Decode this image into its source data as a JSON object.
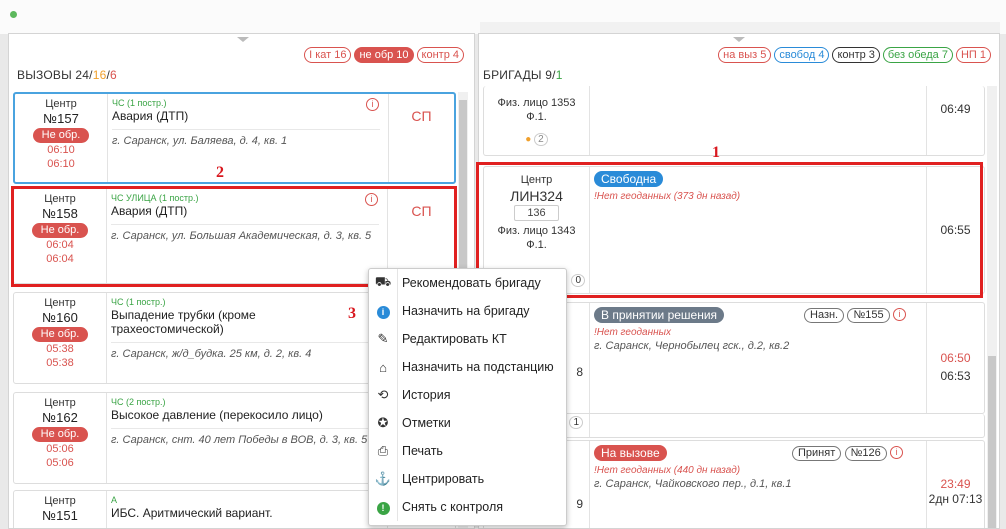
{
  "calls_panel": {
    "title_prefix": "ВЫЗОВЫ 24/",
    "title_a": "16",
    "title_sep": "/",
    "title_b": "6",
    "pills": [
      "I кат 16",
      "не обр 10",
      "контр 4"
    ]
  },
  "brigades_panel": {
    "title_prefix": "БРИГАДЫ 9/",
    "title_a": "1",
    "pills": [
      "на выз 5",
      "свобод 4",
      "контр 3",
      "без обеда 7",
      "НП 1"
    ]
  },
  "calls": [
    {
      "center": "Центр",
      "num": "№157",
      "status": "Не обр.",
      "t1": "06:10",
      "t2": "06:10",
      "cat": "ЧС (1 постр.)",
      "title": "Авария (ДТП)",
      "addr": "г. Саранск, ул. Баляева, д. 4, кв. 1",
      "code": "СП"
    },
    {
      "center": "Центр",
      "num": "№158",
      "status": "Не обр.",
      "t1": "06:04",
      "t2": "06:04",
      "cat": "ЧС УЛИЦА (1 постр.)",
      "title": "Авария (ДТП)",
      "addr": "г. Саранск, ул. Большая Академическая, д. 3, кв. 5",
      "code": "СП"
    },
    {
      "center": "Центр",
      "num": "№160",
      "status": "Не обр.",
      "t1": "05:38",
      "t2": "05:38",
      "cat": "ЧС (1 постр.)",
      "title": "Выпадение трубки (кроме трахеостомической)",
      "addr": "г. Саранск, ж/д_будка. 25 км, д. 2, кв. 4",
      "code": ""
    },
    {
      "center": "Центр",
      "num": "№162",
      "status": "Не обр.",
      "t1": "05:06",
      "t2": "05:06",
      "cat": "ЧС (2 постр.)",
      "title": "Высокое давление (перекосило лицо)",
      "addr": "г. Саранск, снт. 40 лет Победы в ВОВ, д. 3, кв. 5",
      "code": ""
    },
    {
      "center": "Центр",
      "num": "№151",
      "status": "",
      "t1": "",
      "t2": "",
      "cat": "А",
      "title": "ИБС. Аритмический вариант.",
      "addr": "",
      "code": ""
    }
  ],
  "info_glyph": "i",
  "brigades": [
    {
      "id": "b0",
      "center": "",
      "name": "",
      "unit": "",
      "person": "Физ. лицо 1353",
      "person2": "Ф.1.",
      "badge": "2",
      "time": "06:49",
      "time2": "",
      "status": "",
      "status_color": "",
      "warn": "",
      "addr": ""
    },
    {
      "id": "b1",
      "center": "Центр",
      "name": "ЛИН324",
      "unit": "136",
      "person": "Физ. лицо 1343",
      "person2": "Ф.1.",
      "badge": "0",
      "time": "06:55",
      "time2": "",
      "status": "Свободна",
      "status_color": "#2a8bd8",
      "warn": "!Нет геоданных (373 дн назад)",
      "addr": ""
    },
    {
      "id": "b2",
      "center": "",
      "name": "",
      "unit": "",
      "person": "",
      "person2": "",
      "badge": "8",
      "time": "06:50",
      "time2": "06:53",
      "status": "В принятии решения",
      "status_color": "#6c7a89",
      "warn": "!Нет геоданных",
      "addr": "г. Саранск, Чернобылец гск., д.2, кв.2",
      "tag1": "Назн.",
      "tag2": "№155"
    },
    {
      "id": "b3",
      "center": "",
      "name": "",
      "unit": "",
      "person": "",
      "person2": "",
      "badge": "1",
      "time": "",
      "time2": "",
      "status": "",
      "status_color": "",
      "warn": "",
      "addr": ""
    },
    {
      "id": "b4",
      "center": "",
      "name": "",
      "unit": "",
      "person": "",
      "person2": "",
      "badge": "9",
      "time": "23:49",
      "time2": "2дн 07:13",
      "status": "На вызове",
      "status_color": "#d9534f",
      "warn": "!Нет геоданных (440 дн назад)",
      "addr": "г. Саранск, Чайковского пер., д.1, кв.1",
      "tag1": "Принят",
      "tag2": "№126"
    }
  ],
  "context_menu": [
    {
      "icon": "truck-icon",
      "glyph": "🚚",
      "label": "Рекомендовать бригаду"
    },
    {
      "icon": "info-circle-icon",
      "glyph": "i",
      "label": "Назначить на бригаду"
    },
    {
      "icon": "pencil-icon",
      "glyph": "✎",
      "label": "Редактировать КТ"
    },
    {
      "icon": "home-icon",
      "glyph": "⌂",
      "label": "Назначить на подстанцию"
    },
    {
      "icon": "history-icon",
      "glyph": "⟲",
      "label": "История"
    },
    {
      "icon": "star-circle-icon",
      "glyph": "✪",
      "label": "Отметки"
    },
    {
      "icon": "print-icon",
      "glyph": "⎙",
      "label": "Печать"
    },
    {
      "icon": "center-map-icon",
      "glyph": "⚓",
      "label": "Центрировать"
    },
    {
      "icon": "exclamation-circle-icon",
      "glyph": "!",
      "label": "Снять с контроля"
    }
  ],
  "annotations": [
    "1",
    "2",
    "3"
  ]
}
